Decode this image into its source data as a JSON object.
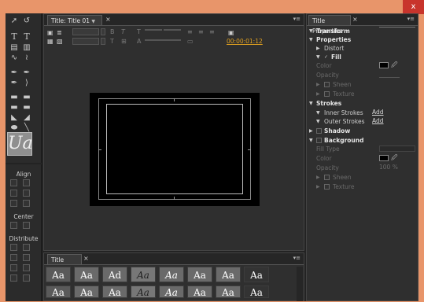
{
  "window": {
    "close_glyph": "x"
  },
  "title_panel": {
    "tab_label": "Title: Title 01",
    "tab_dropdown": "▼",
    "close_glyph": "×",
    "menu_glyph": "▾≡",
    "timecode": "00:00:01:12"
  },
  "properties": {
    "tab_label": "Title Properties",
    "close_glyph": "×",
    "menu_glyph": "▾≡",
    "transform": "Transform",
    "properties": "Properties",
    "distort": "Distort",
    "fill": "Fill",
    "fill_color": "Color",
    "fill_opacity": "Opacity",
    "fill_sheen": "Sheen",
    "fill_texture": "Texture",
    "strokes": "Strokes",
    "inner_strokes": "Inner Strokes",
    "outer_strokes": "Outer Strokes",
    "add1": "Add",
    "add2": "Add",
    "shadow": "Shadow",
    "background": "Background",
    "fill_type": "Fill Type",
    "bg_color": "Color",
    "bg_opacity": "Opacity",
    "bg_opacity_value": "100 %",
    "bg_sheen": "Sheen",
    "bg_texture": "Texture"
  },
  "actions": {
    "align": "Align",
    "center": "Center",
    "distribute": "Distribute"
  },
  "styles": {
    "tab_label": "Title Styles",
    "close_glyph": "×",
    "menu_glyph": "▾≡",
    "row1": [
      "Aa",
      "Aa",
      "Ad",
      "Aa",
      "Aa",
      "Aa",
      "Aa",
      "Aa"
    ],
    "row2": [
      "Aa",
      "Aa",
      "Aa",
      "Aa",
      "Aa",
      "Aa",
      "Aa",
      "Aa"
    ]
  },
  "tools": {
    "preview_glyph": "Ua"
  },
  "colors": {
    "accent_timecode": "#e0a020",
    "window_frame": "#e8956a",
    "close_red": "#c8342c"
  }
}
